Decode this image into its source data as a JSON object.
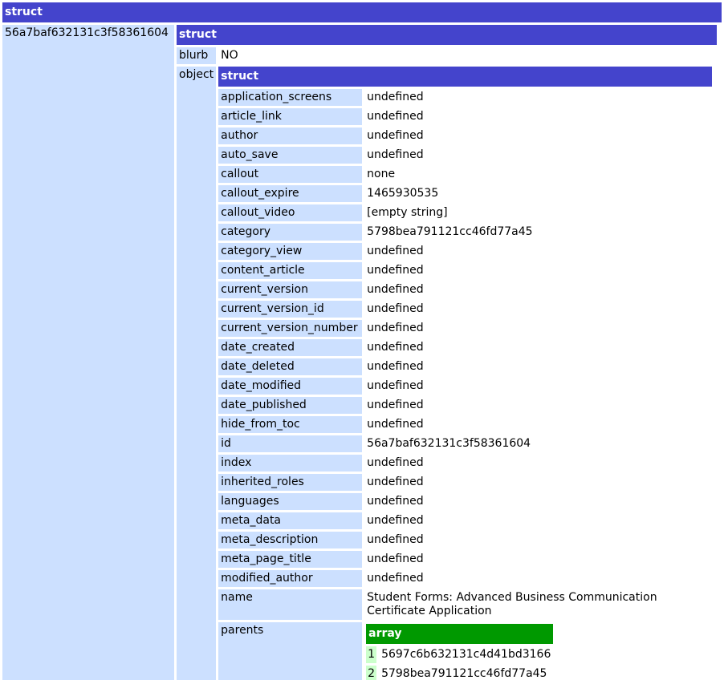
{
  "outer": {
    "header": "struct",
    "key": "56a7baf632131c3f58361604"
  },
  "mid": {
    "header": "struct",
    "blurb_key": "blurb",
    "blurb_value": "NO",
    "object_key": "object"
  },
  "inner": {
    "header": "struct",
    "rows": [
      {
        "key": "application_screens",
        "value": "undefined"
      },
      {
        "key": "article_link",
        "value": "undefined"
      },
      {
        "key": "author",
        "value": "undefined"
      },
      {
        "key": "auto_save",
        "value": "undefined"
      },
      {
        "key": "callout",
        "value": "none"
      },
      {
        "key": "callout_expire",
        "value": "1465930535"
      },
      {
        "key": "callout_video",
        "value": "[empty string]"
      },
      {
        "key": "category",
        "value": "5798bea791121cc46fd77a45"
      },
      {
        "key": "category_view",
        "value": "undefined"
      },
      {
        "key": "content_article",
        "value": "undefined"
      },
      {
        "key": "current_version",
        "value": "undefined"
      },
      {
        "key": "current_version_id",
        "value": "undefined"
      },
      {
        "key": "current_version_number",
        "value": "undefined"
      },
      {
        "key": "date_created",
        "value": "undefined"
      },
      {
        "key": "date_deleted",
        "value": "undefined"
      },
      {
        "key": "date_modified",
        "value": "undefined"
      },
      {
        "key": "date_published",
        "value": "undefined"
      },
      {
        "key": "hide_from_toc",
        "value": "undefined"
      },
      {
        "key": "id",
        "value": "56a7baf632131c3f58361604"
      },
      {
        "key": "index",
        "value": "undefined"
      },
      {
        "key": "inherited_roles",
        "value": "undefined"
      },
      {
        "key": "languages",
        "value": "undefined"
      },
      {
        "key": "meta_data",
        "value": "undefined"
      },
      {
        "key": "meta_description",
        "value": "undefined"
      },
      {
        "key": "meta_page_title",
        "value": "undefined"
      },
      {
        "key": "modified_author",
        "value": "undefined"
      },
      {
        "key": "name",
        "value": "Student Forms: Advanced Business Communication Certificate Application"
      }
    ],
    "parents": {
      "key": "parents",
      "header": "array",
      "items": [
        {
          "index": "1",
          "value": "5697c6b632131c4d41bd3166"
        },
        {
          "index": "2",
          "value": "5798bea791121cc46fd77a45"
        }
      ]
    }
  },
  "colors": {
    "struct_header": "#4444cc",
    "struct_key_bg": "#cce0ff",
    "array_header": "#009900",
    "array_index_bg": "#ccffcc"
  }
}
